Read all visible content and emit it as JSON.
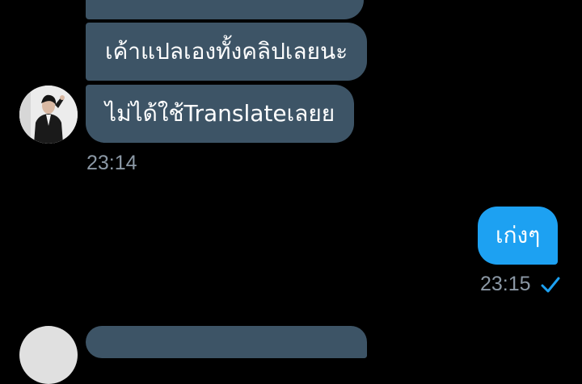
{
  "messages": {
    "incoming": [
      {
        "text": ""
      },
      {
        "text": "เค้าแปลเองทั้งคลิปเลยนะ"
      },
      {
        "text": "ไม่ได้ใช้Translateเลยย"
      }
    ],
    "incoming_time": "23:14",
    "outgoing": [
      {
        "text": "เก่งๆ"
      }
    ],
    "outgoing_time": "23:15"
  },
  "icons": {
    "read_receipt": "check-icon",
    "avatar": "profile-avatar"
  },
  "colors": {
    "background": "#000000",
    "incoming_bubble": "#3d5466",
    "outgoing_bubble": "#1da1f2",
    "timestamp": "#8b98a5",
    "check": "#1da1f2"
  }
}
